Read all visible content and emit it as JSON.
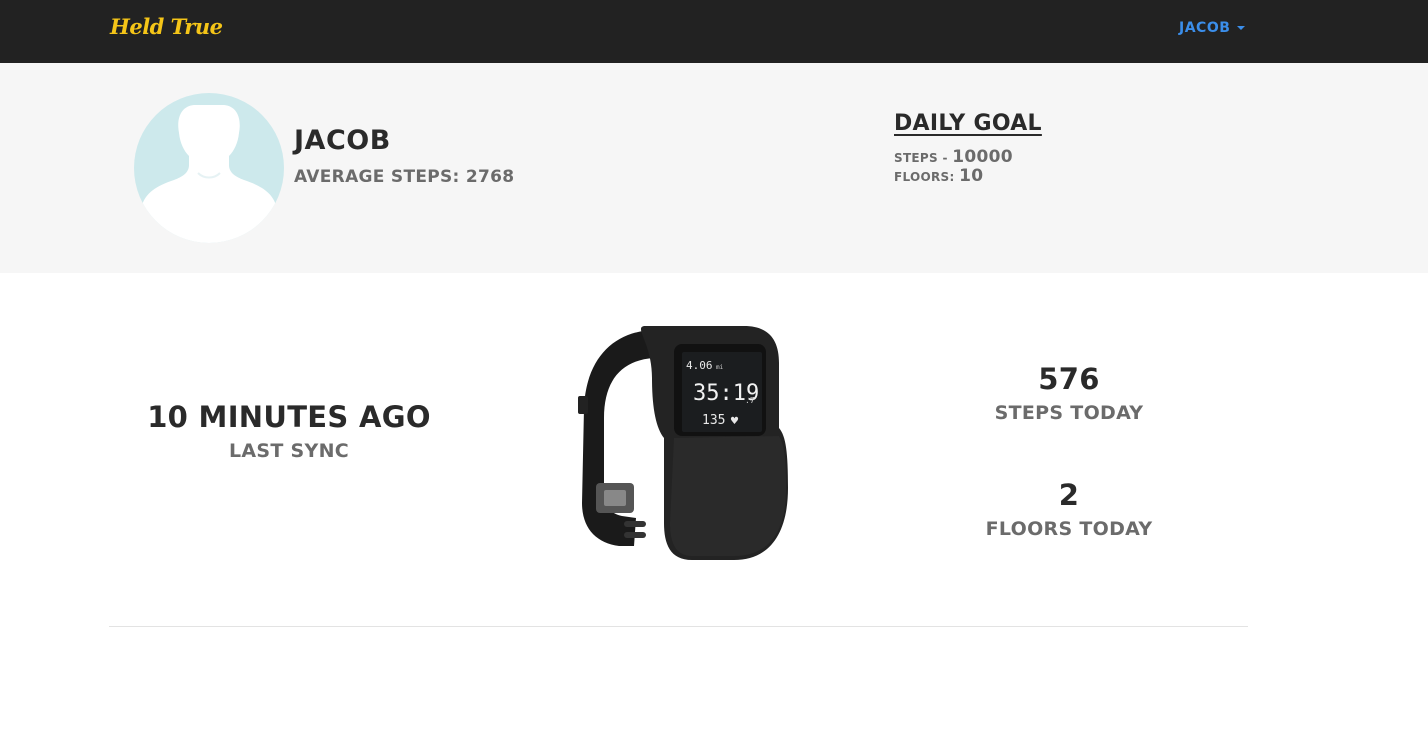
{
  "navbar": {
    "brand": "Held True",
    "user_menu": "JACOB"
  },
  "profile": {
    "name": "JACOB",
    "average_steps_label": "AVERAGE STEPS:",
    "average_steps_value": "2768"
  },
  "daily_goal": {
    "title": "DAILY GOAL",
    "steps_label": "STEPS -",
    "steps_value": "10000",
    "floors_label": "FLOORS:",
    "floors_value": "10"
  },
  "stats": {
    "last_sync_value": "10 MINUTES AGO",
    "last_sync_label": "LAST SYNC",
    "steps_today_value": "576",
    "steps_today_label": "STEPS TODAY",
    "floors_today_value": "2",
    "floors_today_label": "FLOORS TODAY"
  },
  "device": {
    "icon": "fitness-watch",
    "screen_distance": "4.06",
    "screen_distance_unit": "mi",
    "screen_time": "35:19",
    "screen_time_tenths": ".7",
    "screen_heart_rate": "135"
  },
  "colors": {
    "navbar_bg": "#222222",
    "brand": "#f5c518",
    "user_menu": "#3b8eea",
    "profile_band_bg": "#f6f6f6",
    "avatar_bg": "#cde9ec"
  }
}
